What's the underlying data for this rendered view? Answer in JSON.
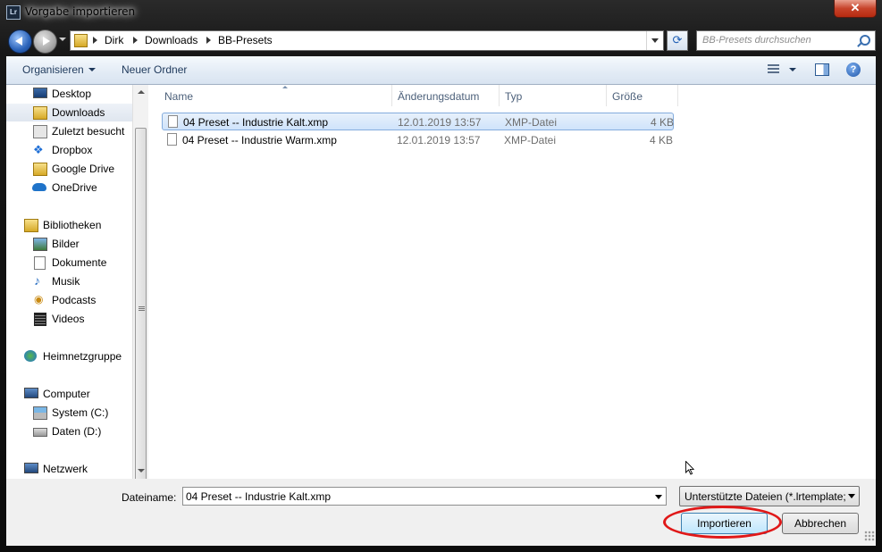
{
  "window": {
    "title": "Vorgabe importieren",
    "app_icon": "Lr",
    "close_glyph": "✕"
  },
  "nav": {
    "breadcrumbs": [
      "Dirk",
      "Downloads",
      "BB-Presets"
    ],
    "search_placeholder": "BB-Presets durchsuchen"
  },
  "toolbar": {
    "organize": "Organisieren",
    "new_folder": "Neuer Ordner",
    "help": "?"
  },
  "sidebar": {
    "favorites": [
      {
        "label": "Desktop",
        "icon": "desktop-icon",
        "selected": false
      },
      {
        "label": "Downloads",
        "icon": "downloads-folder-icon",
        "selected": true
      },
      {
        "label": "Zuletzt besucht",
        "icon": "recent-places-icon",
        "selected": false
      },
      {
        "label": "Dropbox",
        "icon": "dropbox-icon",
        "selected": false
      },
      {
        "label": "Google Drive",
        "icon": "google-drive-icon",
        "selected": false
      },
      {
        "label": "OneDrive",
        "icon": "onedrive-icon",
        "selected": false
      }
    ],
    "libraries_label": "Bibliotheken",
    "libraries": [
      {
        "label": "Bilder",
        "icon": "pictures-icon"
      },
      {
        "label": "Dokumente",
        "icon": "documents-icon"
      },
      {
        "label": "Musik",
        "icon": "music-icon"
      },
      {
        "label": "Podcasts",
        "icon": "podcasts-icon"
      },
      {
        "label": "Videos",
        "icon": "videos-icon"
      }
    ],
    "homegroup_label": "Heimnetzgruppe",
    "computer_label": "Computer",
    "drives": [
      {
        "label": "System (C:)",
        "icon": "system-drive-icon"
      },
      {
        "label": "Daten (D:)",
        "icon": "data-drive-icon"
      }
    ],
    "network_label": "Netzwerk"
  },
  "columns": {
    "name": "Name",
    "date": "Änderungsdatum",
    "type": "Typ",
    "size": "Größe"
  },
  "files": [
    {
      "name": "04 Preset -- Industrie Kalt.xmp",
      "date": "12.01.2019 13:57",
      "type": "XMP-Datei",
      "size": "4 KB",
      "selected": true
    },
    {
      "name": "04 Preset -- Industrie Warm.xmp",
      "date": "12.01.2019 13:57",
      "type": "XMP-Datei",
      "size": "4 KB",
      "selected": false
    }
  ],
  "footer": {
    "filename_label": "Dateiname:",
    "filename_value": "04 Preset -- Industrie Kalt.xmp",
    "filetype_value": "Unterstützte Dateien (*.lrtemplate;",
    "import_button": "Importieren",
    "cancel_button": "Abbrechen"
  },
  "colors": {
    "highlight_ring": "#e01818",
    "selection": "#cfe3fb"
  }
}
